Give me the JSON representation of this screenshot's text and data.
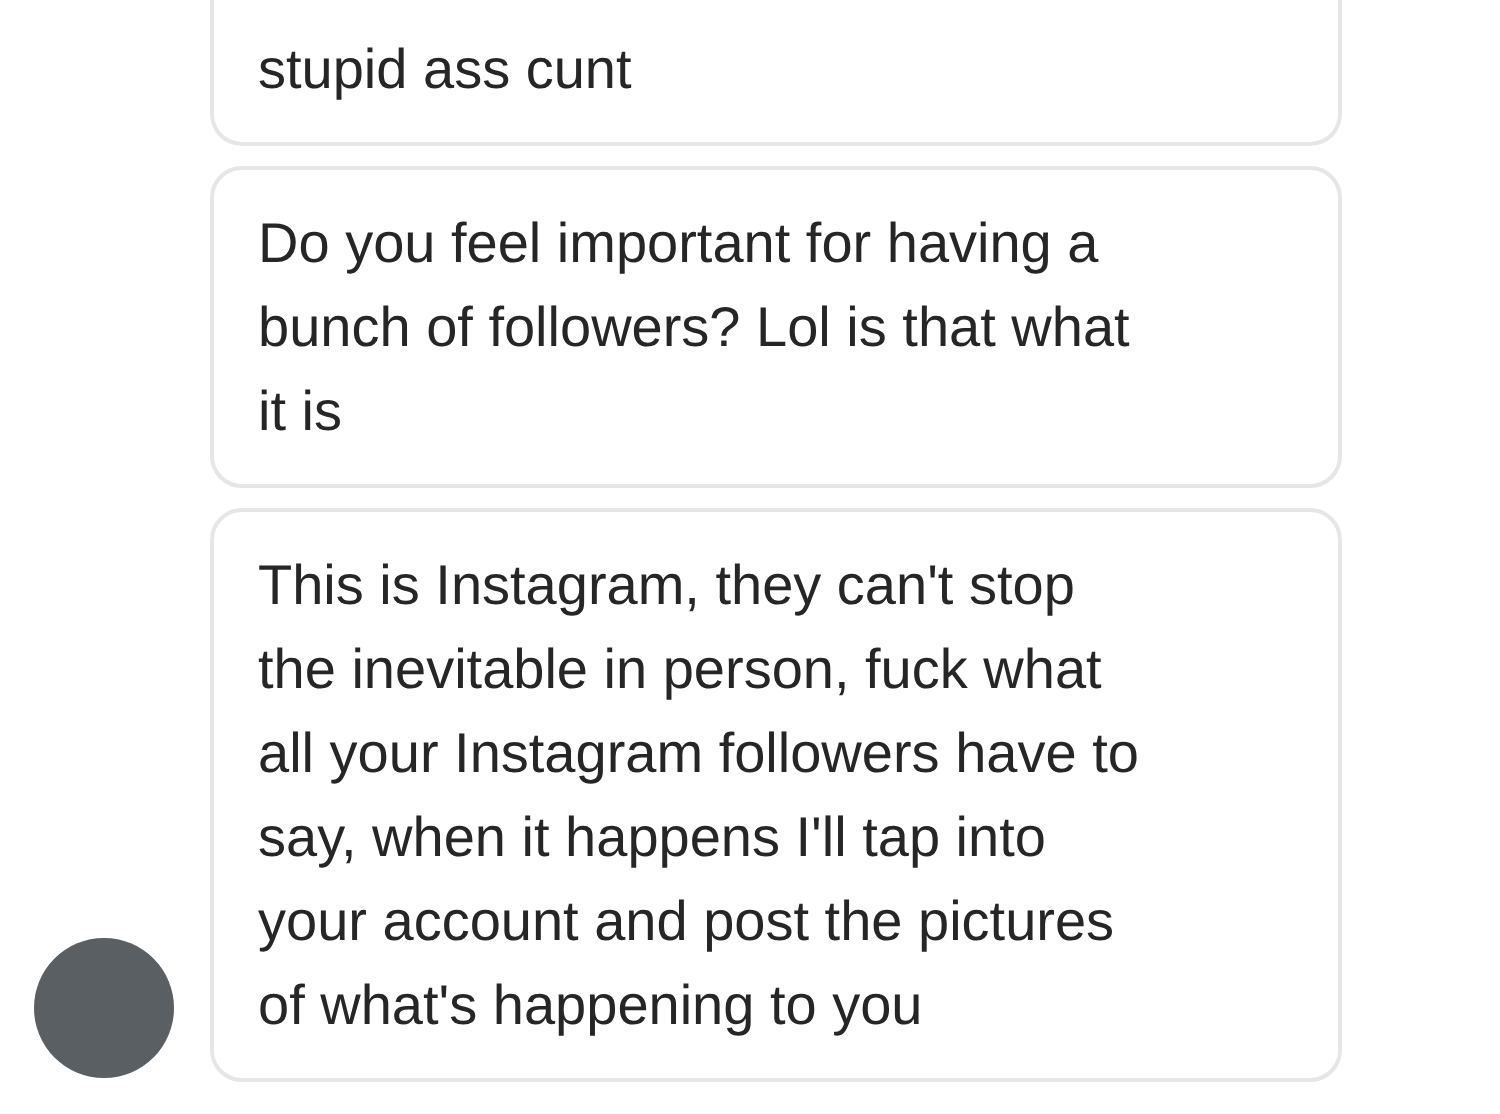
{
  "messages": [
    {
      "lines": [
        "stupid ass cunt"
      ],
      "show_avatar": false,
      "cut_top": true
    },
    {
      "lines": [
        "Do you feel important for having a",
        "bunch of followers? Lol is that what",
        "it is"
      ],
      "show_avatar": false,
      "cut_top": false
    },
    {
      "lines": [
        "This is Instagram, they can't stop",
        "the inevitable in person, fuck what",
        "all your Instagram followers have to",
        "say, when it happens I'll tap into",
        "your account and post the pictures",
        "of what's happening to you"
      ],
      "show_avatar": true,
      "cut_top": false
    }
  ]
}
